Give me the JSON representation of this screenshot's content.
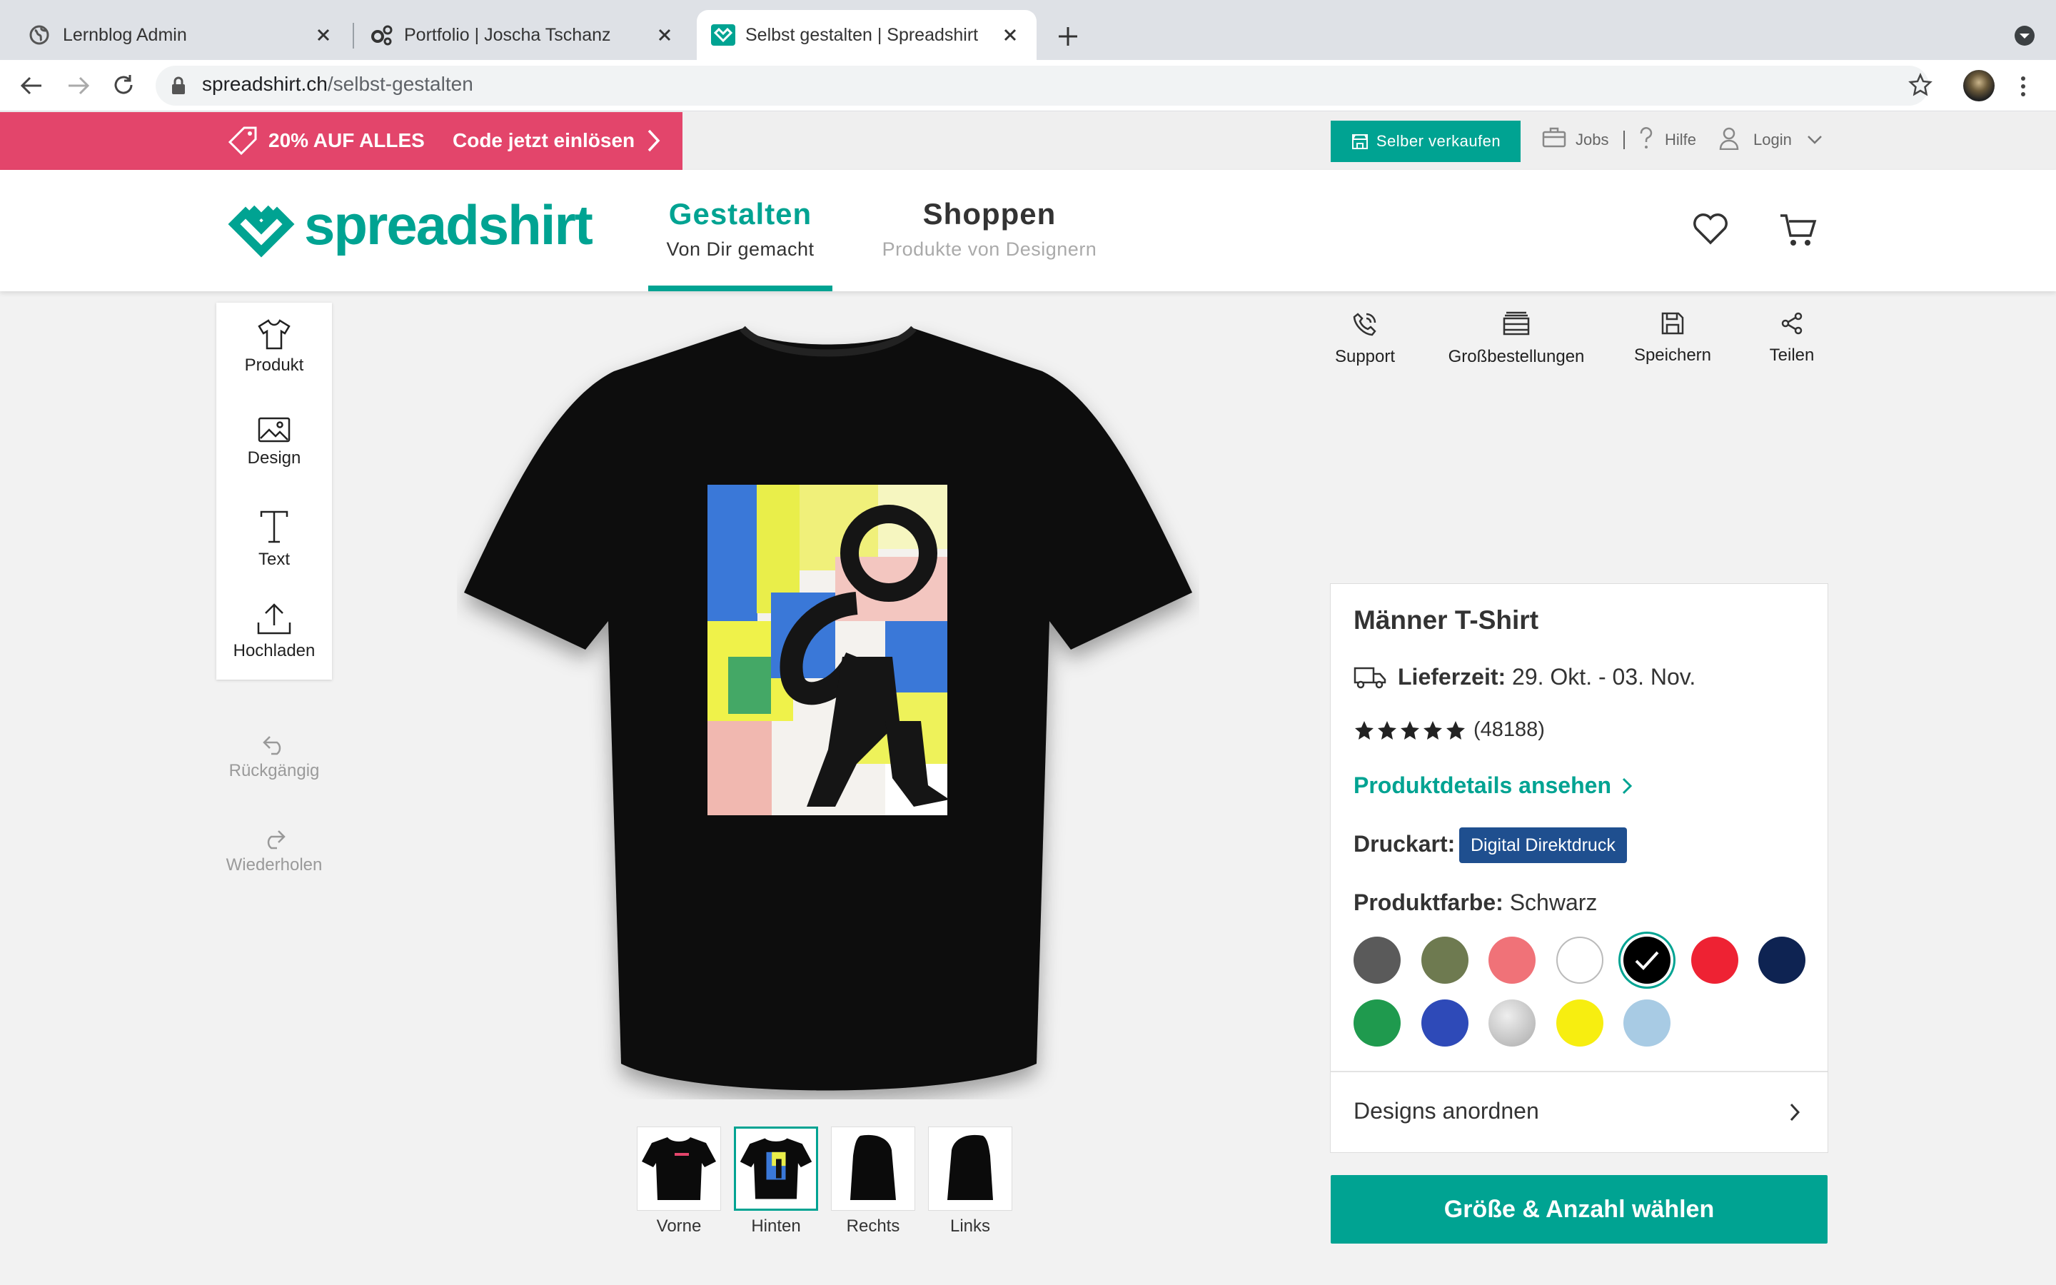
{
  "browser": {
    "tabs": [
      {
        "title": "Lernblog Admin"
      },
      {
        "title": "Portfolio | Joscha Tschanz"
      },
      {
        "title": "Selbst gestalten | Spreadshirt"
      }
    ],
    "url_host": "spreadshirt.ch",
    "url_path": "/selbst-gestalten"
  },
  "promo": {
    "discount": "20% AUF ALLES",
    "redeem": "Code jetzt einlösen"
  },
  "topbar": {
    "sell_button": "Selber verkaufen",
    "jobs": "Jobs",
    "help": "Hilfe",
    "login": "Login"
  },
  "header": {
    "logo": "spreadshirt",
    "nav": [
      {
        "title": "Gestalten",
        "subtitle": "Von Dir gemacht"
      },
      {
        "title": "Shoppen",
        "subtitle": "Produkte von Designern"
      }
    ]
  },
  "tools": {
    "items": [
      "Produkt",
      "Design",
      "Text",
      "Hochladen"
    ],
    "undo": "Rückgängig",
    "redo": "Wiederholen"
  },
  "actions": [
    "Support",
    "Großbestellungen",
    "Speichern",
    "Teilen"
  ],
  "views": [
    "Vorne",
    "Hinten",
    "Rechts",
    "Links"
  ],
  "product": {
    "name": "Männer T-Shirt",
    "delivery_label": "Lieferzeit:",
    "delivery_value": "29. Okt. - 03. Nov.",
    "rating": 5,
    "reviews": "(48188)",
    "details_link": "Produktdetails ansehen",
    "print_label": "Druckart:",
    "print_value": "Digital Direktdruck",
    "color_label": "Produktfarbe:",
    "color_value": "Schwarz",
    "colors": [
      "#5a5a5a",
      "#6e7a50",
      "#f07278",
      "#ffffff",
      "#000000",
      "#ee2233",
      "#0e2352",
      "#1f9a4e",
      "#2e4ab8",
      "#c8c8c8",
      "#f7ee10",
      "#a8cbe4"
    ],
    "selected_color": 4,
    "arrange": "Designs anordnen",
    "cta": "Größe & Anzahl wählen"
  },
  "colors": {
    "brand": "#00a392",
    "promo": "#e3456b",
    "print_badge": "#1f4f8f"
  }
}
